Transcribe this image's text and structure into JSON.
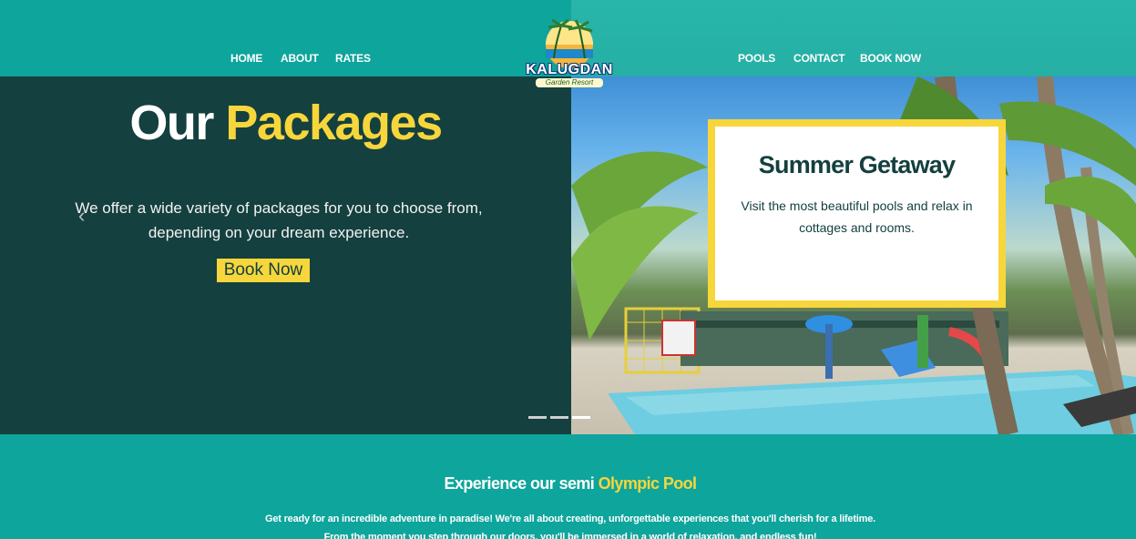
{
  "nav": {
    "left_links": [
      "HOME",
      "ABOUT",
      "RATES"
    ],
    "right_links": [
      "POOLS",
      "CONTACT",
      "BOOK NOW"
    ]
  },
  "logo": {
    "name": "KALUGDAN",
    "tagline": "Garden Resort"
  },
  "hero": {
    "title_white": "Our",
    "title_accent": "Packages",
    "desc_line1": "We offer a wide variety of packages for you to choose from,",
    "desc_line2": "depending on your dream experience.",
    "prev_arrow": "‹",
    "book_button": "Book Now"
  },
  "package_card": {
    "title": "Summer Getaway",
    "text": "Visit the most beautiful pools and relax in cottages and rooms."
  },
  "carousel": {
    "slide_count": 3,
    "active_index": 2
  },
  "pool_section": {
    "title_white": "Experience our semi",
    "title_accent": "Olympic Pool",
    "line1": "Get ready for an incredible adventure in paradise! We're all about creating, unforgettable experiences that you'll cherish for a lifetime.",
    "line2": "From the moment you step through our doors, you'll be immersed in a world of relaxation, and endless fun!"
  },
  "colors": {
    "teal": "#0ea59c",
    "dark_green": "#14403f",
    "yellow": "#f7d63c",
    "white": "#ffffff"
  }
}
